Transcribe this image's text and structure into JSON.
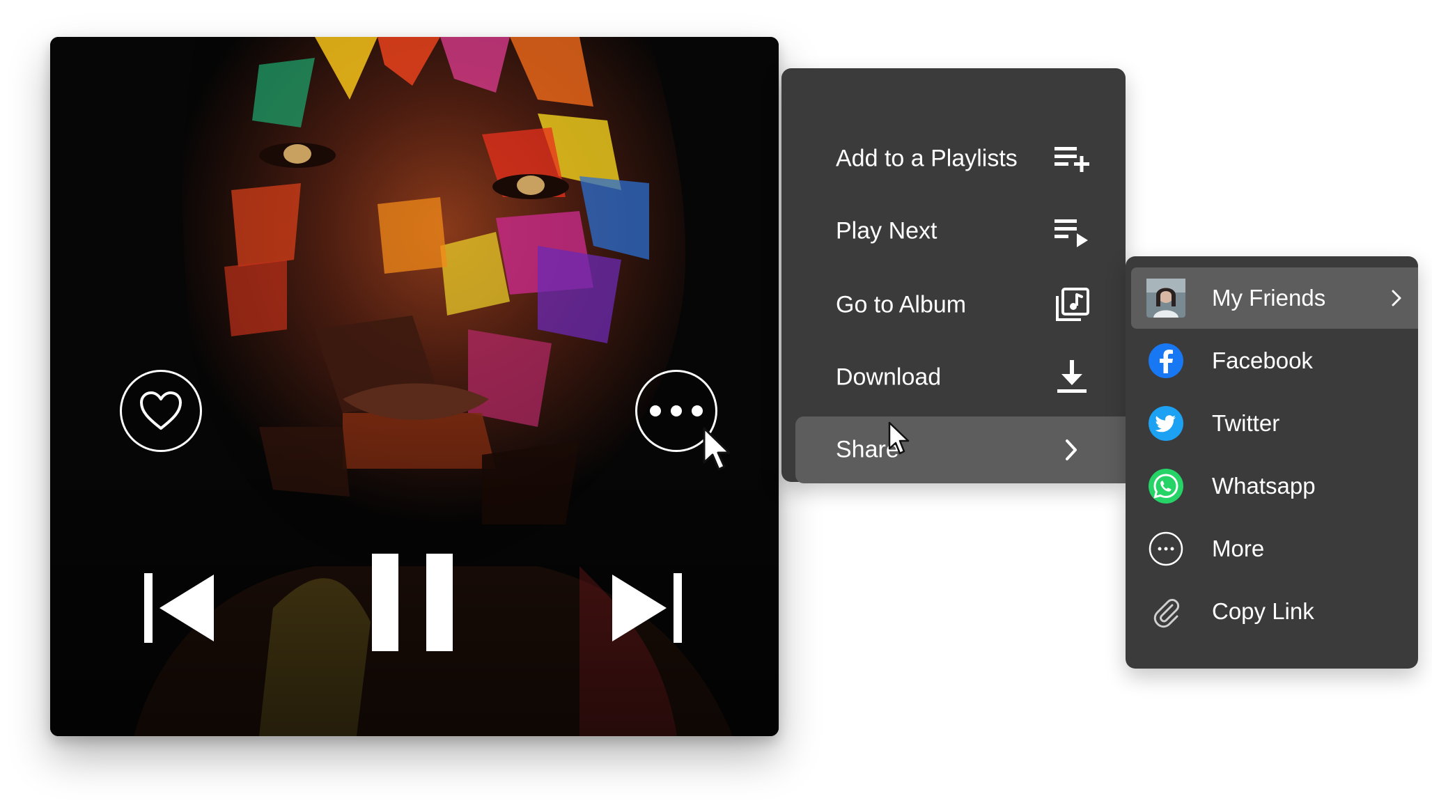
{
  "player": {
    "like_icon": "heart-outline-icon",
    "more_icon": "more-dots-icon",
    "controls": [
      "skip-previous-icon",
      "pause-icon",
      "skip-next-icon"
    ]
  },
  "context_menu": {
    "items": [
      {
        "label": "Add to a Playlists",
        "icon": "playlist-add-icon"
      },
      {
        "label": "Play Next",
        "icon": "play-next-icon"
      },
      {
        "label": "Go to Album",
        "icon": "album-icon"
      },
      {
        "label": "Download",
        "icon": "download-icon"
      },
      {
        "label": "Share",
        "icon": "chevron-right-icon",
        "active": true
      }
    ]
  },
  "share_menu": {
    "items": [
      {
        "label": "My Friends",
        "icon": "friend-avatar",
        "active": true,
        "has_submenu": true
      },
      {
        "label": "Facebook",
        "icon": "facebook-icon",
        "color": "#1877F2"
      },
      {
        "label": "Twitter",
        "icon": "twitter-icon",
        "color": "#1DA1F2"
      },
      {
        "label": "Whatsapp",
        "icon": "whatsapp-icon",
        "color": "#25D366"
      },
      {
        "label": "More",
        "icon": "more-circle-icon"
      },
      {
        "label": "Copy Link",
        "icon": "paperclip-icon"
      }
    ]
  },
  "colors": {
    "menu_bg": "#3b3b3b",
    "menu_highlight": "#5d5d5d",
    "menu_text": "#ffffff"
  }
}
